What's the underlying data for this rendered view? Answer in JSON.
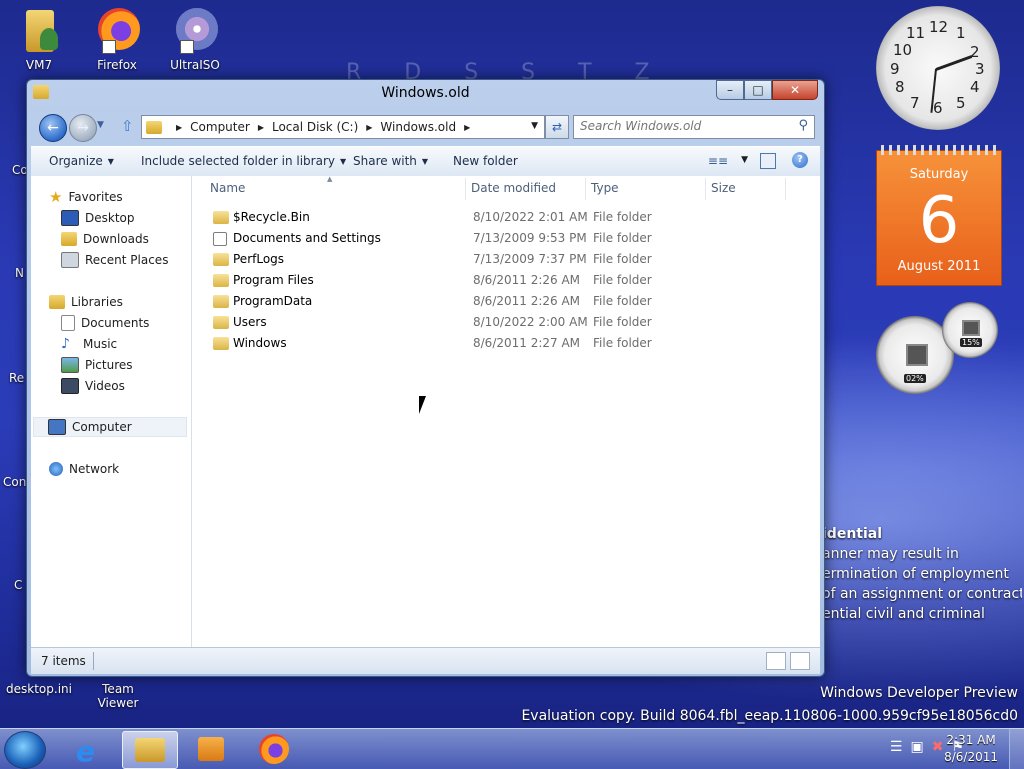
{
  "desktop": {
    "icons": [
      {
        "label": "VM7"
      },
      {
        "label": "Firefox"
      },
      {
        "label": "UltraISO"
      }
    ],
    "bottom_icons": [
      {
        "label": "desktop.ini"
      },
      {
        "label": "Team Viewer"
      }
    ],
    "partial_labels": [
      "Co",
      "N",
      "Re",
      "Con",
      "C"
    ],
    "confidential": {
      "title": "idential",
      "lines": [
        "anner may result in",
        "ermination of employment",
        "of an assignment or contract",
        "ential civil and criminal"
      ]
    },
    "watermark": {
      "line1": "Windows Developer Preview",
      "line2": "Evaluation copy. Build 8064.fbl_eeap.110806-1000.959cf95e18056cd0"
    },
    "bg_letters": "R D S S T Z"
  },
  "gadgets": {
    "clock_numbers": [
      "12",
      "1",
      "2",
      "3",
      "4",
      "5",
      "6",
      "7",
      "8",
      "9",
      "10",
      "11"
    ],
    "calendar": {
      "day": "Saturday",
      "date": "6",
      "month": "August 2011"
    },
    "meter_cpu": "02%",
    "meter_mem": "15%"
  },
  "window": {
    "title": "Windows.old",
    "caption_buttons": {
      "minimize": "–",
      "maximize": "□",
      "close": "✕"
    },
    "breadcrumb": [
      "Computer",
      "Local Disk (C:)",
      "Windows.old"
    ],
    "search_placeholder": "Search Windows.old",
    "toolbar": {
      "organize": "Organize",
      "include": "Include selected folder in library",
      "share": "Share with",
      "new_folder": "New folder"
    },
    "nav": {
      "favorites": "Favorites",
      "desktop": "Desktop",
      "downloads": "Downloads",
      "recent": "Recent Places",
      "libraries": "Libraries",
      "documents": "Documents",
      "music": "Music",
      "pictures": "Pictures",
      "videos": "Videos",
      "computer": "Computer",
      "network": "Network"
    },
    "columns": {
      "name": "Name",
      "date": "Date modified",
      "type": "Type",
      "size": "Size"
    },
    "files": [
      {
        "name": "$Recycle.Bin",
        "date": "8/10/2022 2:01 AM",
        "type": "File folder"
      },
      {
        "name": "Documents and Settings",
        "date": "7/13/2009 9:53 PM",
        "type": "File folder"
      },
      {
        "name": "PerfLogs",
        "date": "7/13/2009 7:37 PM",
        "type": "File folder"
      },
      {
        "name": "Program Files",
        "date": "8/6/2011 2:26 AM",
        "type": "File folder"
      },
      {
        "name": "ProgramData",
        "date": "8/6/2011 2:26 AM",
        "type": "File folder"
      },
      {
        "name": "Users",
        "date": "8/10/2022 2:00 AM",
        "type": "File folder"
      },
      {
        "name": "Windows",
        "date": "8/6/2011 2:27 AM",
        "type": "File folder"
      }
    ],
    "status": "7 items"
  },
  "taskbar": {
    "time": "2:31 AM",
    "date": "8/6/2011"
  }
}
